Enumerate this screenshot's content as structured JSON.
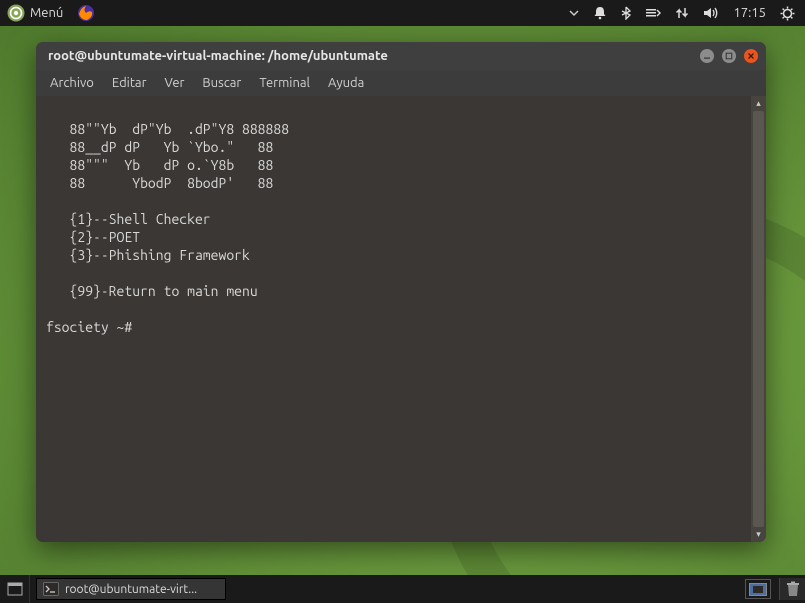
{
  "top_panel": {
    "menu_label": "Menú",
    "time": "17:15"
  },
  "window": {
    "title": "root@ubuntumate-virtual-machine: /home/ubuntumate",
    "menu": {
      "archivo": "Archivo",
      "editar": "Editar",
      "ver": "Ver",
      "buscar": "Buscar",
      "terminal": "Terminal",
      "ayuda": "Ayuda"
    }
  },
  "terminal": {
    "ascii_line1": "   88\"\"Yb  dP\"Yb  .dP\"Y8 888888",
    "ascii_line2": "   88__dP dP   Yb `Ybo.\"   88",
    "ascii_line3": "   88\"\"\"  Yb   dP o.`Y8b   88",
    "ascii_line4": "   88      YbodP  8bodP'   88",
    "opt1": "   {1}--Shell Checker",
    "opt2": "   {2}--POET",
    "opt3": "   {3}--Phishing Framework",
    "opt99": "   {99}-Return to main menu",
    "prompt": "fsociety ~# "
  },
  "taskbar": {
    "active_task": "root@ubuntumate-virt..."
  }
}
